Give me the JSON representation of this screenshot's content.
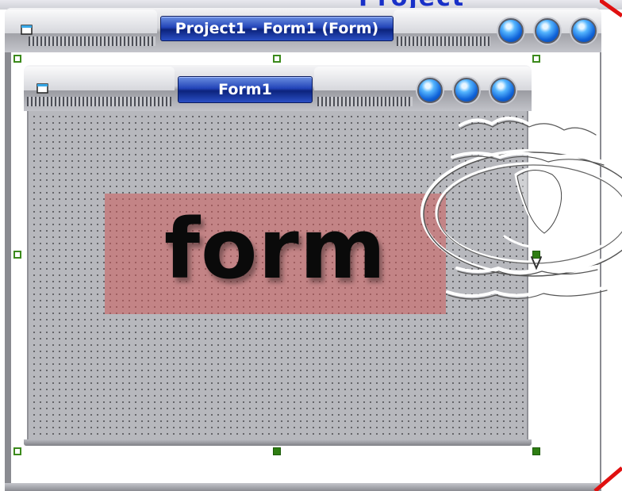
{
  "background_window": {
    "partial_title": "Project"
  },
  "outer_window": {
    "title": "Project1 - Form1 (Form)",
    "buttons": [
      "minimize-orb",
      "maximize-orb",
      "close-orb"
    ]
  },
  "inner_form": {
    "title": "Form1",
    "buttons": [
      "minimize-orb",
      "maximize-orb",
      "close-orb"
    ],
    "label_text": "form",
    "label_bg": "#cd5a5a",
    "grid_color": "#b7b8bd"
  },
  "colors": {
    "title_plate": "#1e3da8",
    "handle": "#2e7d12",
    "accent_red": "#e01010"
  },
  "icons": [
    "window-icon",
    "orb-button-icon",
    "sizing-handle-icon",
    "emblem-watermark"
  ]
}
